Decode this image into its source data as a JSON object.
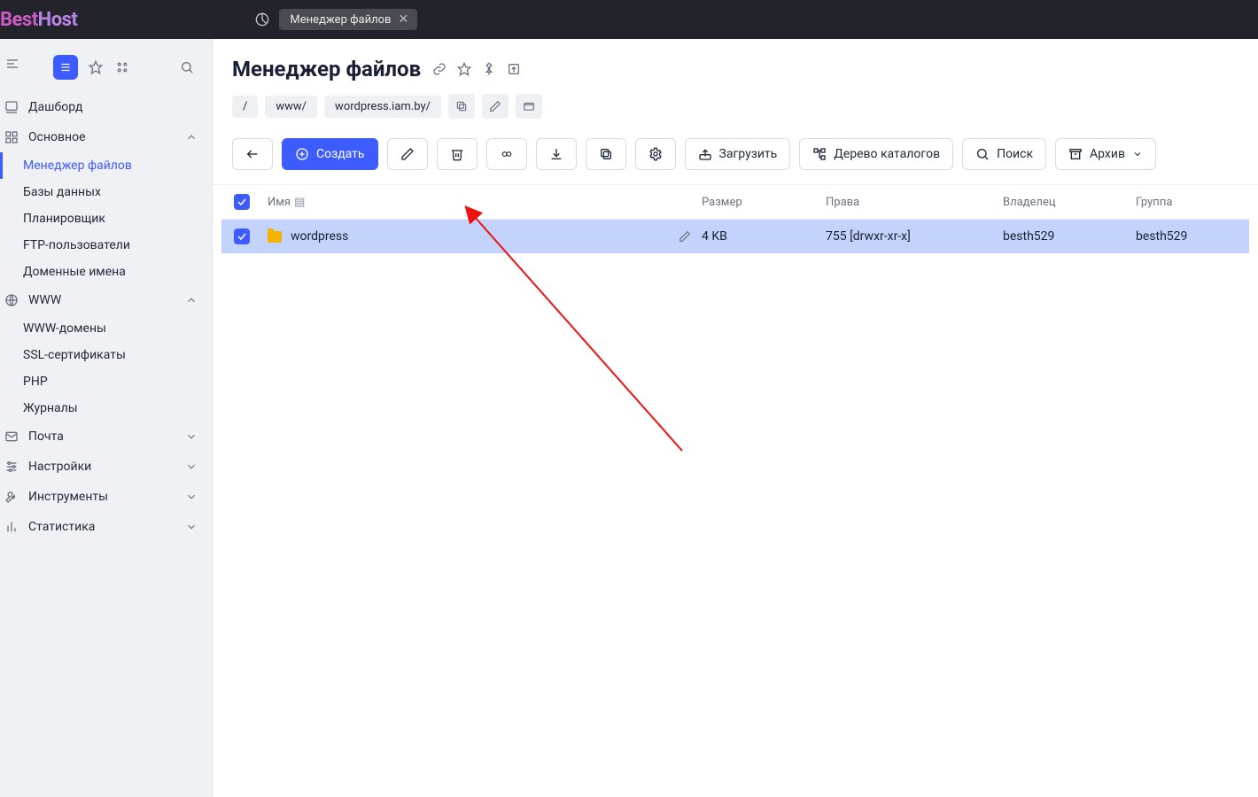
{
  "brand": {
    "half1": "Best",
    "half2": "Host"
  },
  "topbar": {
    "tab_label": "Менеджер файлов"
  },
  "sidebar": {
    "items": [
      {
        "label": "Дашборд"
      },
      {
        "label": "Основное",
        "expanded": true,
        "children": [
          {
            "label": "Менеджер файлов",
            "active": true
          },
          {
            "label": "Базы данных"
          },
          {
            "label": "Планировщик"
          },
          {
            "label": "FTP-пользователи"
          },
          {
            "label": "Доменные имена"
          }
        ]
      },
      {
        "label": "WWW",
        "expanded": true,
        "children": [
          {
            "label": "WWW-домены"
          },
          {
            "label": "SSL-сертификаты"
          },
          {
            "label": "PHP"
          },
          {
            "label": "Журналы"
          }
        ]
      },
      {
        "label": "Почта"
      },
      {
        "label": "Настройки"
      },
      {
        "label": "Инструменты"
      },
      {
        "label": "Статистика"
      }
    ]
  },
  "page": {
    "title": "Менеджер файлов",
    "breadcrumbs": [
      "/",
      "www/",
      "wordpress.iam.by/"
    ]
  },
  "toolbar": {
    "create": "Создать",
    "upload": "Загрузить",
    "tree": "Дерево каталогов",
    "search": "Поиск",
    "archive": "Архив"
  },
  "table": {
    "headers": {
      "name": "Имя",
      "size": "Размер",
      "perms": "Права",
      "owner": "Владелец",
      "group": "Группа"
    },
    "rows": [
      {
        "name": "wordpress",
        "size": "4 KB",
        "perms": "755 [drwxr-xr-x]",
        "owner": "besth529",
        "group": "besth529",
        "selected": true
      }
    ]
  }
}
